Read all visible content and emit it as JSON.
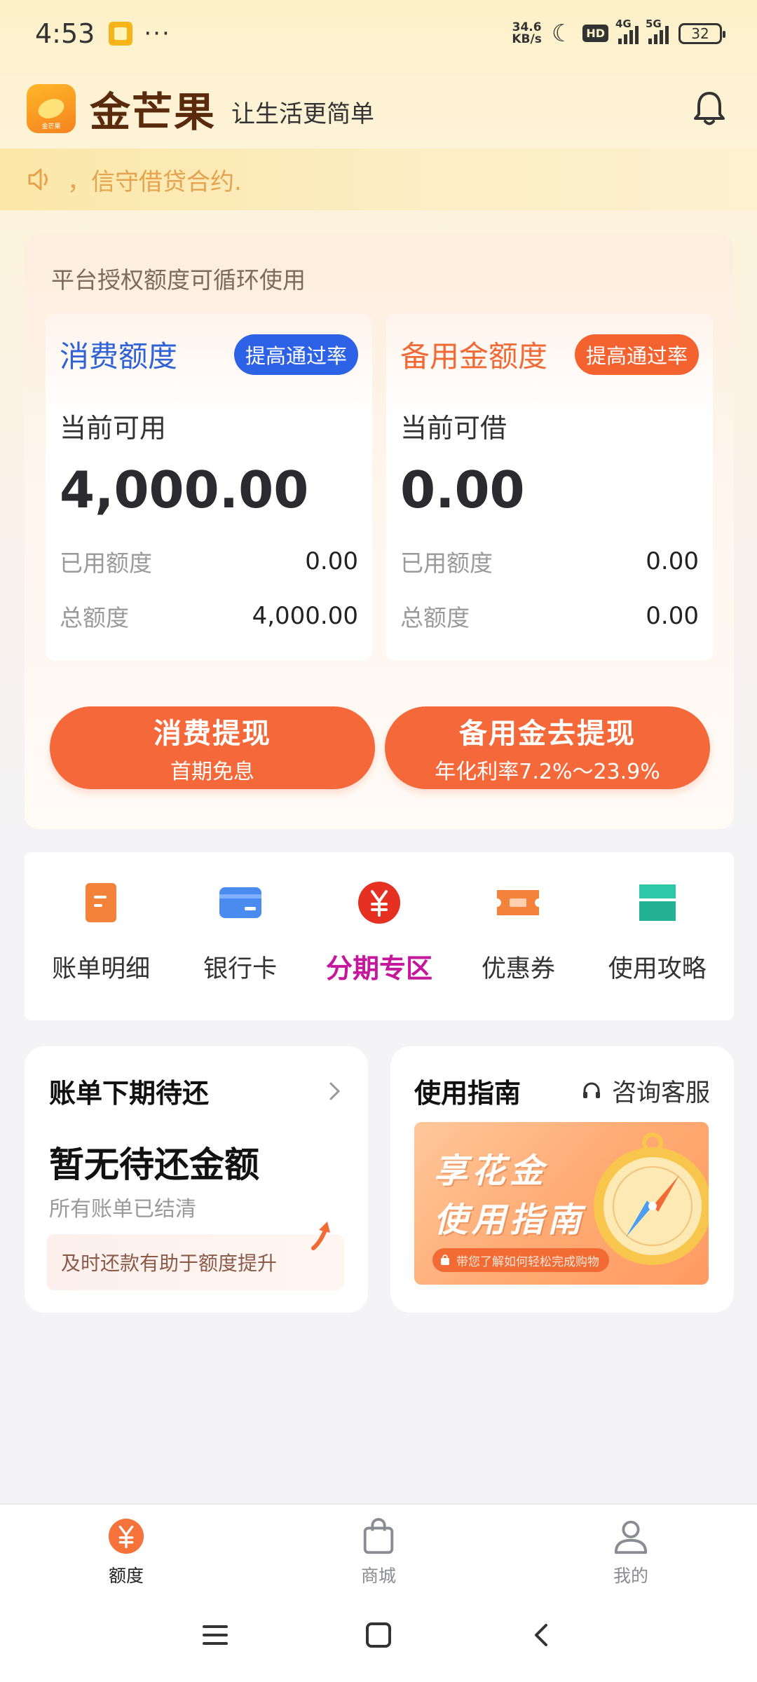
{
  "status_bar": {
    "time": "4:53",
    "net_speed_value": "34.6",
    "net_speed_unit": "KB/s",
    "hd_label": "HD",
    "signal1_label": "4G",
    "signal2_label": "5G",
    "battery": "32"
  },
  "header": {
    "brand": "金芒果",
    "slogan": "让生活更简单",
    "logo_mini_text": "金芒果"
  },
  "notice": {
    "text": "，信守借贷合约."
  },
  "credit": {
    "title": "平台授权额度可循环使用",
    "consumer": {
      "name": "消费额度",
      "raise_label": "提高通过率",
      "avail_label": "当前可用",
      "avail_value": "4,000.00",
      "used_label": "已用额度",
      "used_value": "0.00",
      "total_label": "总额度",
      "total_value": "4,000.00"
    },
    "reserve": {
      "name": "备用金额度",
      "raise_label": "提高通过率",
      "avail_label": "当前可借",
      "avail_value": "0.00",
      "used_label": "已用额度",
      "used_value": "0.00",
      "total_label": "总额度",
      "total_value": "0.00"
    },
    "withdraw_consumer": {
      "main": "消费提现",
      "sub": "首期免息"
    },
    "withdraw_reserve": {
      "main": "备用金去提现",
      "sub": "年化利率7.2%～23.9%"
    }
  },
  "menu": {
    "items": [
      {
        "label": "账单明细",
        "icon": "document-icon"
      },
      {
        "label": "银行卡",
        "icon": "bank-card-icon"
      },
      {
        "label": "分期专区",
        "icon": "yuan-circle-icon"
      },
      {
        "label": "优惠券",
        "icon": "coupon-icon"
      },
      {
        "label": "使用攻略",
        "icon": "guide-book-icon"
      }
    ],
    "active_index": 2,
    "colors": {
      "orange": "#f5823a",
      "blue": "#4a8bf0",
      "red": "#e63022",
      "teal": "#2cc8a8",
      "active": "#c5179c"
    }
  },
  "bill": {
    "title": "账单下期待还",
    "main": "暂无待还金额",
    "sub": "所有账单已结清",
    "tip": "及时还款有助于额度提升"
  },
  "guide": {
    "title": "使用指南",
    "service_label": "咨询客服",
    "banner_line1": "享花金",
    "banner_line2": "使用指南",
    "banner_pill": "带您了解如何轻松完成购物"
  },
  "tabbar": {
    "items": [
      {
        "label": "额度",
        "icon": "yuan-circle-icon"
      },
      {
        "label": "商城",
        "icon": "shopping-bag-icon"
      },
      {
        "label": "我的",
        "icon": "user-icon"
      }
    ],
    "active_index": 0
  },
  "navbar": {
    "icons": [
      "menu-icon",
      "home-square-icon",
      "back-icon"
    ]
  }
}
